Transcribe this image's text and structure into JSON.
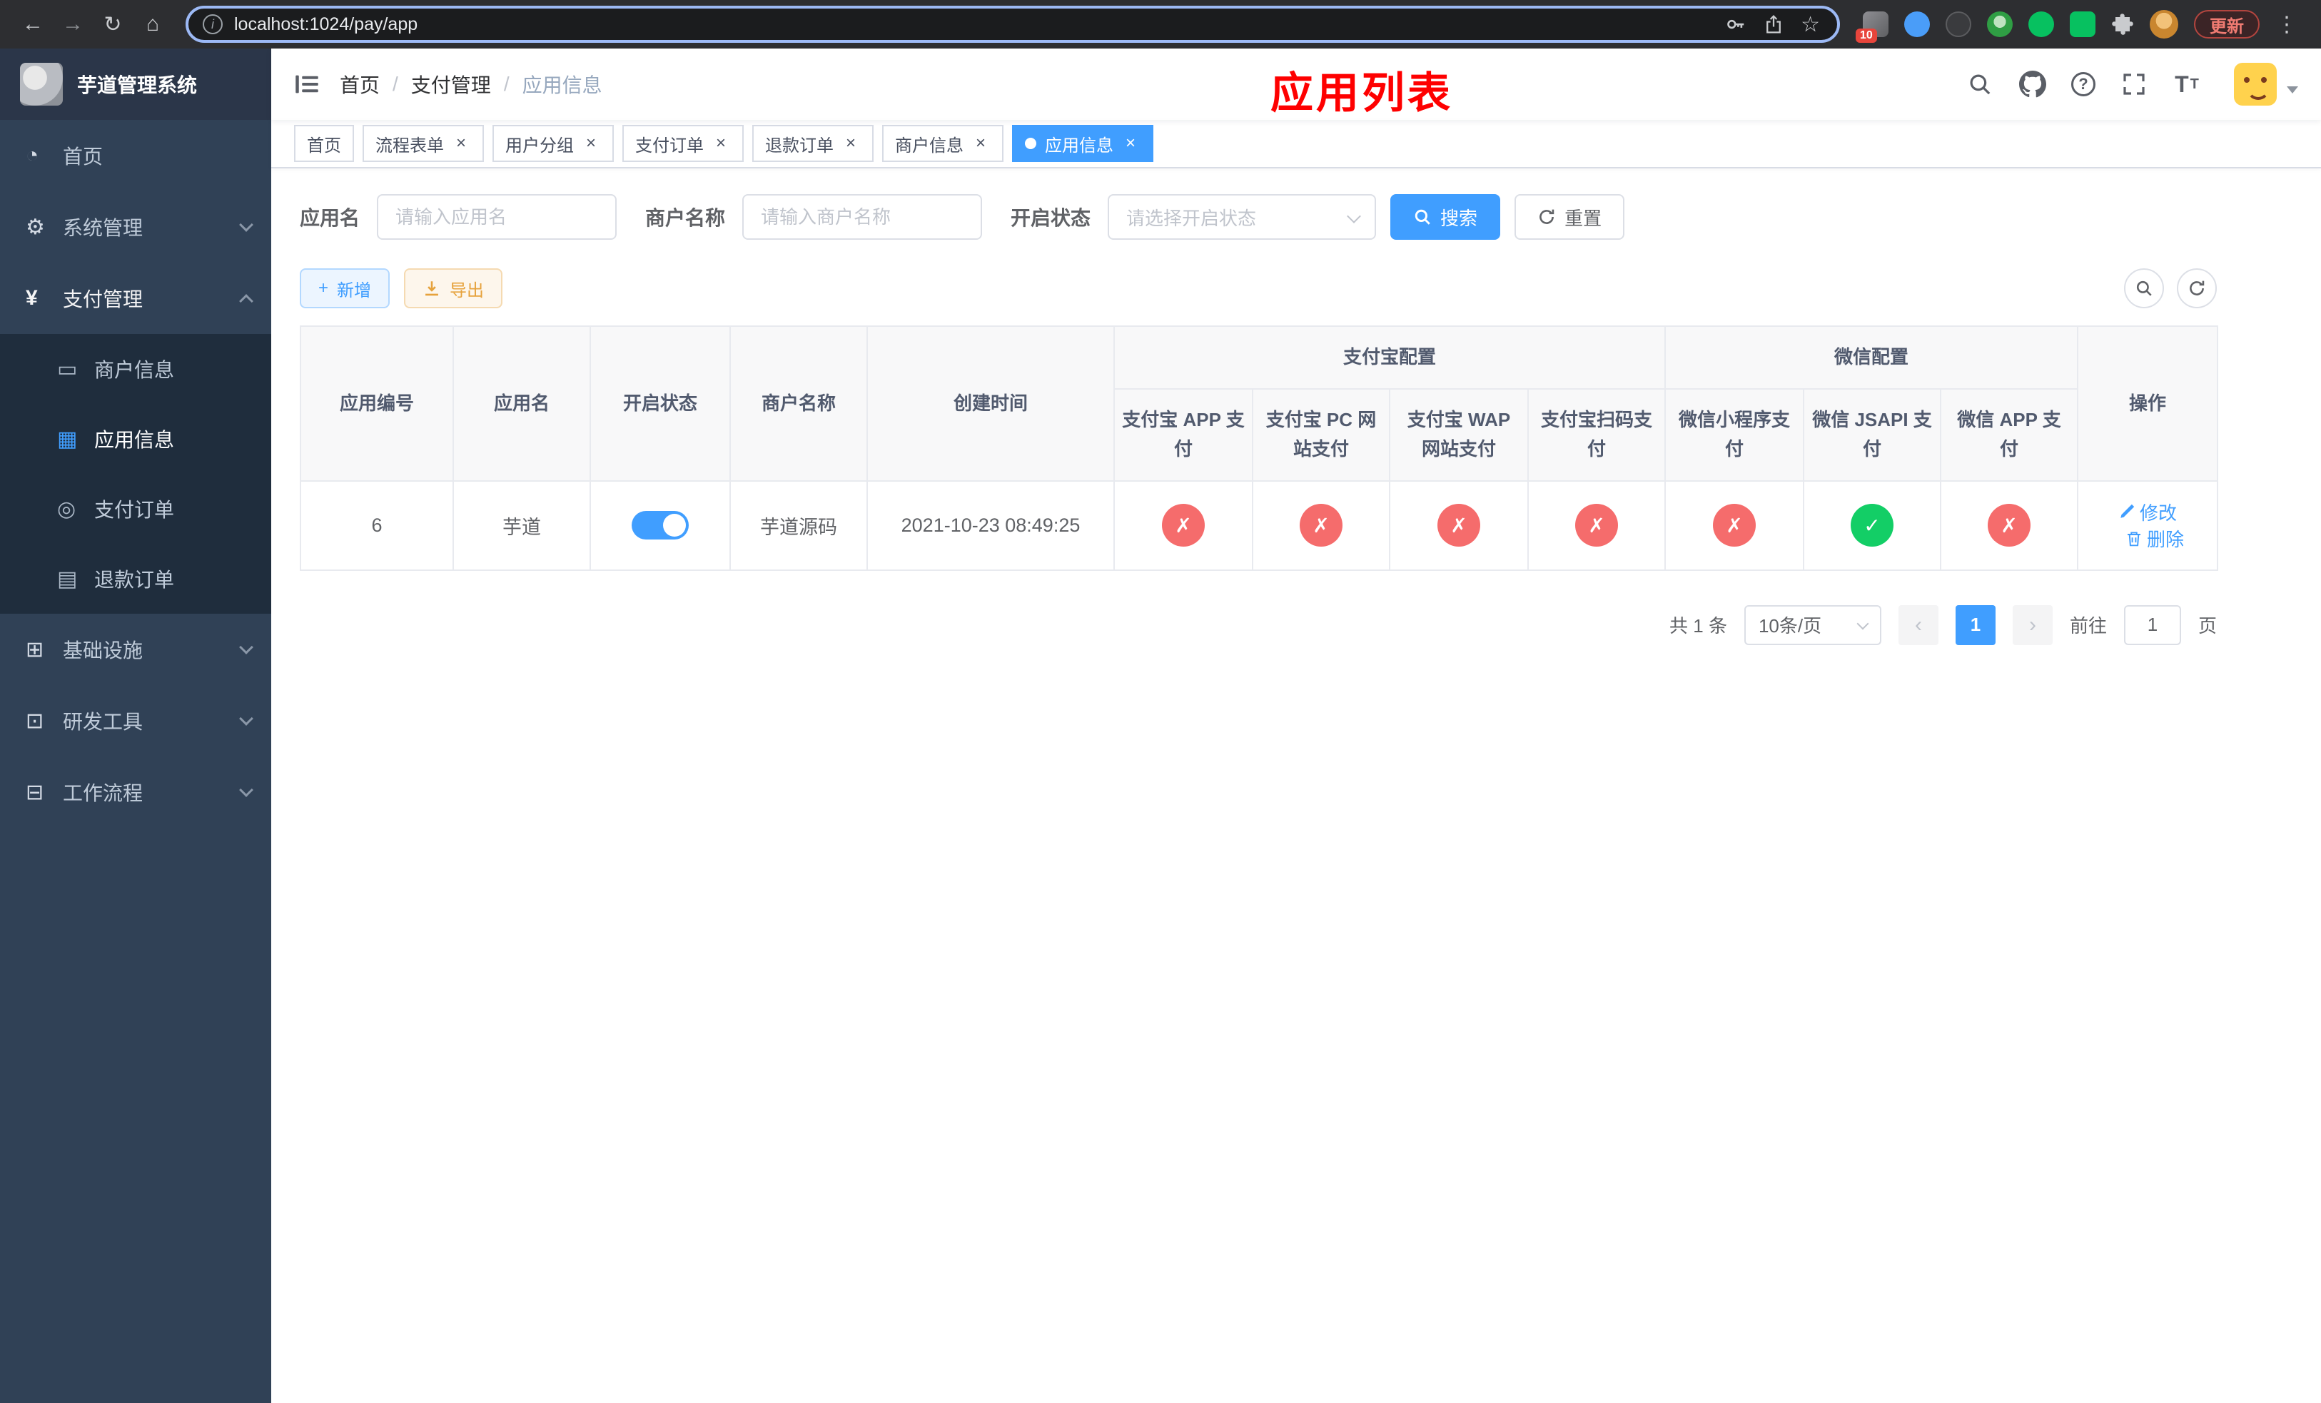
{
  "colors": {
    "accent": "#409eff",
    "success": "#13ce66",
    "danger": "#f56c6c",
    "warning": "#e6a23c",
    "sidebar_bg": "#304156",
    "annotation_red": "#fe0000"
  },
  "browser": {
    "url": "localhost:1024/pay/app",
    "update_label": "更新",
    "extension_badge": "10"
  },
  "sidebar": {
    "title": "芋道管理系统",
    "menu": [
      {
        "label": "首页",
        "icon": "dashboard-icon"
      },
      {
        "label": "系统管理",
        "icon": "gear-icon"
      },
      {
        "label": "支付管理",
        "icon": "yen-icon"
      },
      {
        "label": "商户信息",
        "icon": "merchant-icon"
      },
      {
        "label": "应用信息",
        "icon": "grid-icon"
      },
      {
        "label": "支付订单",
        "icon": "order-icon"
      },
      {
        "label": "退款订单",
        "icon": "refund-icon"
      },
      {
        "label": "基础设施",
        "icon": "infrastructure-icon"
      },
      {
        "label": "研发工具",
        "icon": "devtools-icon"
      },
      {
        "label": "工作流程",
        "icon": "workflow-icon"
      }
    ]
  },
  "header": {
    "breadcrumb": [
      "首页",
      "支付管理",
      "应用信息"
    ],
    "overlay_title": "应用列表",
    "icons": [
      "search-icon",
      "github-icon",
      "docs-icon",
      "fullscreen-icon",
      "font-size-icon",
      "avatar",
      "caret-down-icon"
    ]
  },
  "tabs": [
    {
      "label": "首页"
    },
    {
      "label": "流程表单"
    },
    {
      "label": "用户分组"
    },
    {
      "label": "支付订单"
    },
    {
      "label": "退款订单"
    },
    {
      "label": "商户信息"
    },
    {
      "label": "应用信息"
    }
  ],
  "filters": {
    "app_name_label": "应用名",
    "app_name_placeholder": "请输入应用名",
    "app_name_value": "",
    "merchant_label": "商户名称",
    "merchant_placeholder": "请输入商户名称",
    "merchant_value": "",
    "status_label": "开启状态",
    "status_placeholder": "请选择开启状态",
    "search_label": "搜索",
    "reset_label": "重置"
  },
  "toolbar": {
    "add_label": "新增",
    "export_label": "导出"
  },
  "table": {
    "headers": {
      "app_id": "应用编号",
      "app_name": "应用名",
      "status": "开启状态",
      "merchant": "商户名称",
      "created": "创建时间",
      "alipay_group": "支付宝配置",
      "wechat_group": "微信配置",
      "alipay_app": "支付宝 APP 支付",
      "alipay_pc": "支付宝 PC 网站支付",
      "alipay_wap": "支付宝 WAP 网站支付",
      "alipay_qr": "支付宝扫码支付",
      "wx_mini": "微信小程序支付",
      "wx_jsapi": "微信 JSAPI 支付",
      "wx_app": "微信 APP 支付",
      "actions": "操作"
    },
    "rows": [
      {
        "app_id": "6",
        "app_name": "芋道",
        "status_on": true,
        "merchant": "芋道源码",
        "created": "2021-10-23 08:49:25",
        "configs": {
          "alipay_app": false,
          "alipay_pc": false,
          "alipay_wap": false,
          "alipay_qr": false,
          "wx_mini": false,
          "wx_jsapi": true,
          "wx_app": false
        },
        "edit_label": "修改",
        "delete_label": "删除"
      }
    ]
  },
  "pagination": {
    "total_text": "共 1 条",
    "page_size": "10条/页",
    "current_page": "1",
    "goto_label": "前往",
    "goto_value": "1",
    "page_unit": "页"
  }
}
